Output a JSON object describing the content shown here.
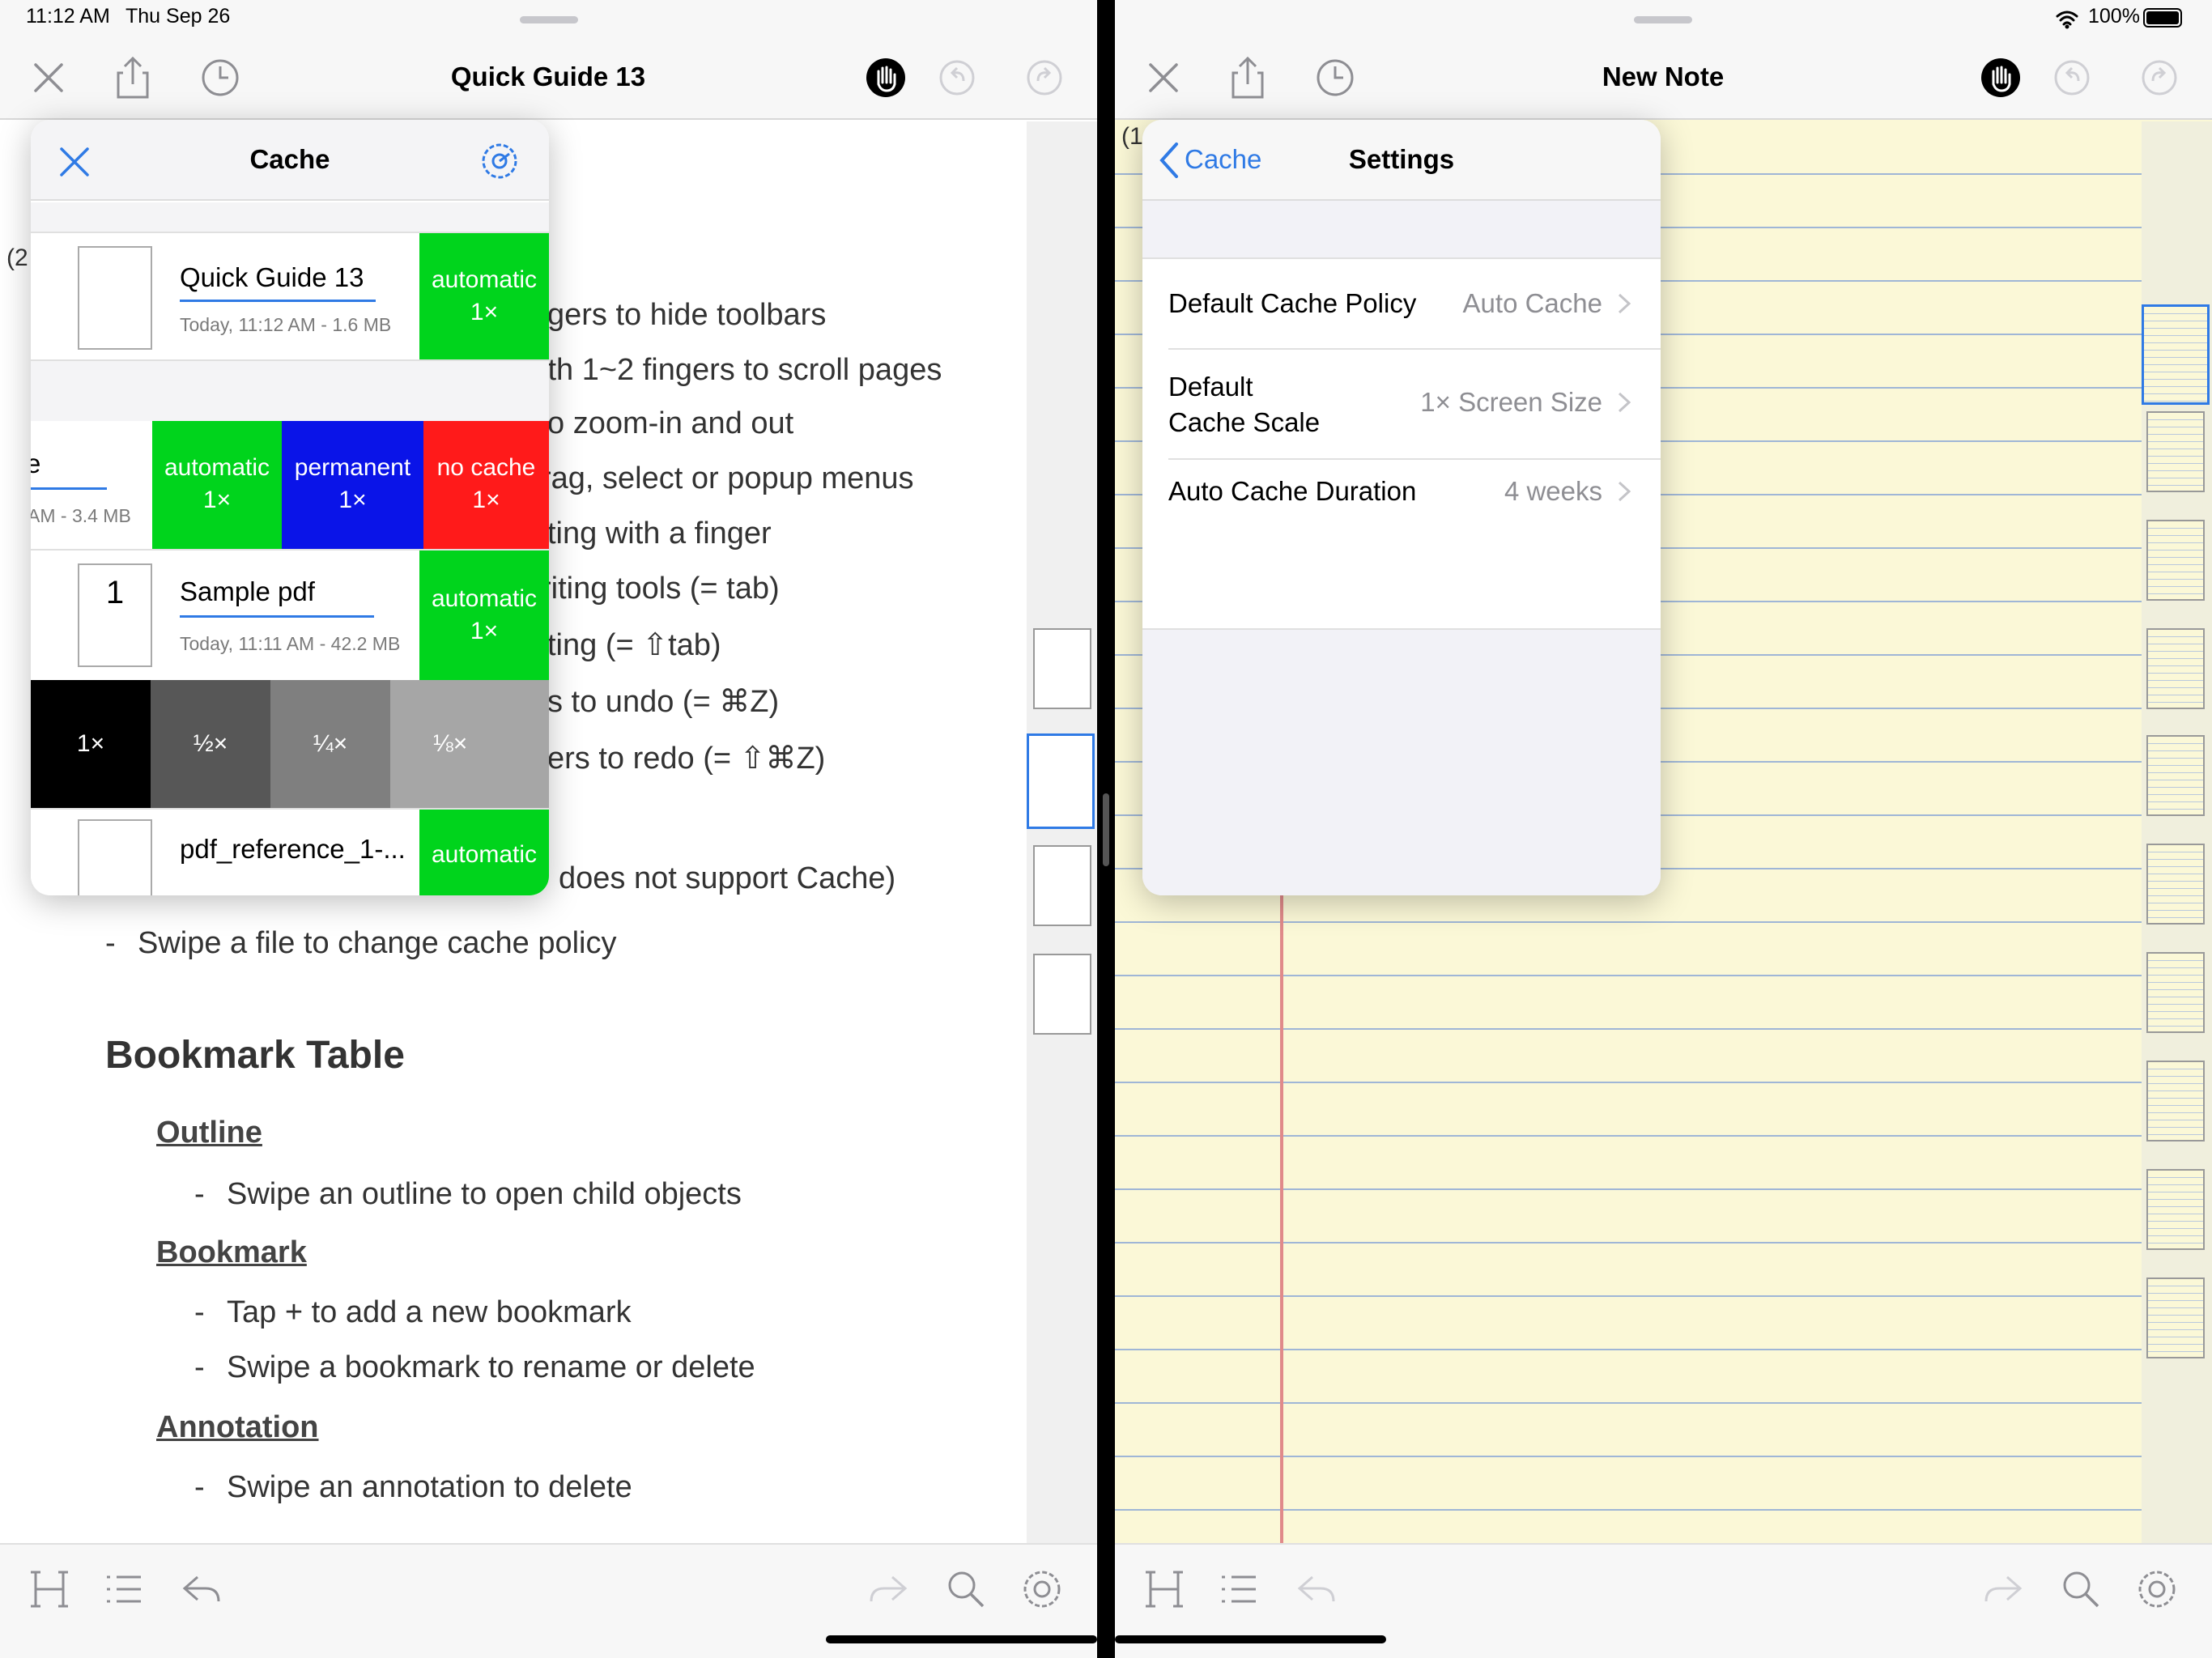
{
  "status_bar": {
    "time": "11:12 AM",
    "date": "Thu Sep 26",
    "battery": "100%"
  },
  "left": {
    "title": "Quick Guide 13",
    "page_index": "(2",
    "doc_lines": [
      "gers to hide toolbars",
      "ith 1~2 fingers to scroll pages",
      "o zoom-in and out",
      "rag, select or popup menus",
      "ting with a finger",
      "riting tools (= tab)",
      "ting (= ⇧tab)",
      "s to undo (= ⌘Z)",
      "ers to redo (= ⇧⌘Z)",
      "does not support Cache)"
    ],
    "bullet_dash": "-",
    "swipe_line": "Swipe a file to change cache policy",
    "bookmark_table": "Bookmark Table",
    "outline": "Outline",
    "outline_item": "Swipe an outline to open child objects",
    "bookmark": "Bookmark",
    "bookmark_item1": "Tap + to add a new bookmark",
    "bookmark_item2": "Swipe a bookmark to rename or delete",
    "annotation": "Annotation",
    "annotation_item": "Swipe an annotation to delete"
  },
  "cache_popover": {
    "title": "Cache",
    "files": [
      {
        "name": "Quick Guide 13",
        "meta": "Today, 11:12 AM - 1.6 MB",
        "policy": "automatic",
        "scale": "1×"
      },
      {
        "name": "e",
        "meta": "AM - 3.4 MB"
      },
      {
        "name": "Sample pdf",
        "meta": "Today, 11:11 AM - 42.2 MB",
        "policy": "automatic",
        "scale": "1×",
        "thumb_label": "1"
      },
      {
        "name": "pdf_reference_1-...",
        "policy": "automatic"
      }
    ],
    "policy_actions": [
      {
        "label": "automatic",
        "scale": "1×",
        "color": "#00d41c"
      },
      {
        "label": "permanent",
        "scale": "1×",
        "color": "#0a14e8"
      },
      {
        "label": "no cache",
        "scale": "1×",
        "color": "#ff1a1a"
      }
    ],
    "scale_actions": [
      {
        "label": "1×",
        "color": "#000000"
      },
      {
        "label": "½×",
        "color": "#575757"
      },
      {
        "label": "¼×",
        "color": "#7f7f7f"
      },
      {
        "label": "⅛×",
        "color": "#a6a6a6"
      }
    ]
  },
  "right": {
    "title": "New Note",
    "page_index": "(1"
  },
  "settings_popover": {
    "back_label": "Cache",
    "title": "Settings",
    "rows": [
      {
        "label": "Default Cache Policy",
        "value": "Auto Cache"
      },
      {
        "label": "Default\nCache Scale",
        "value": "1× Screen Size"
      },
      {
        "label": "Auto Cache Duration",
        "value": "4 weeks"
      }
    ]
  },
  "colors": {
    "accent": "#2f7ae5",
    "note_paper": "#fbf8d7"
  }
}
